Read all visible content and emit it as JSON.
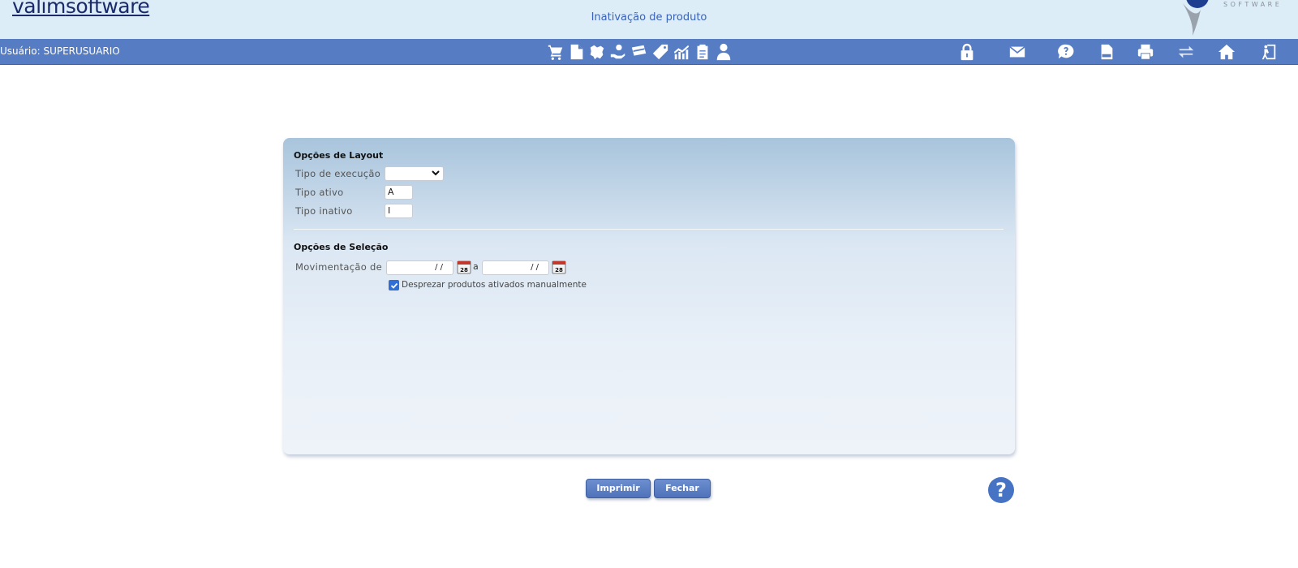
{
  "header": {
    "logo_part1": "valim",
    "logo_part2": "software",
    "title": "Inativação de produto",
    "corner_tagline": "SOFTWARE"
  },
  "toolbar": {
    "user_label": "Usuário: SUPERUSUARIO",
    "center_icons": [
      "cart-icon",
      "document-icon",
      "map-icon",
      "hand-money-icon",
      "card-icon",
      "tag-icon",
      "chart-icon",
      "clipboard-icon",
      "user-icon"
    ],
    "right_icons": [
      "lock-icon",
      "mail-icon",
      "chat-help-icon",
      "sql-icon",
      "print-icon",
      "exchange-icon",
      "home-icon",
      "exit-icon"
    ]
  },
  "layout_section": {
    "title": "Opções de Layout",
    "tipo_execucao_label": "Tipo de execução",
    "tipo_execucao_value": "",
    "tipo_ativo_label": "Tipo ativo",
    "tipo_ativo_value": "A",
    "tipo_inativo_label": "Tipo inativo",
    "tipo_inativo_value": "I"
  },
  "selection_section": {
    "title": "Opções de Seleção",
    "movimentacao_label": "Movimentação de",
    "date_from": "/ /",
    "date_to": "/ /",
    "separator": "a",
    "calendar_day": "28",
    "checkbox_label": "Desprezar produtos ativados manualmente",
    "checkbox_checked": true
  },
  "buttons": {
    "print_label": "Imprimir",
    "close_label": "Fechar",
    "help_label": "?"
  }
}
